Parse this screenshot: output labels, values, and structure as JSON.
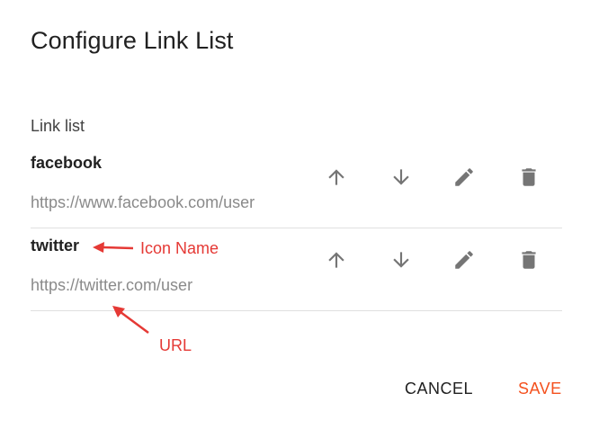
{
  "dialog": {
    "title": "Configure Link List"
  },
  "link_list": {
    "label": "Link list",
    "items": [
      {
        "name": "facebook",
        "url": "https://www.facebook.com/user"
      },
      {
        "name": "twitter",
        "url": "https://twitter.com/user"
      }
    ]
  },
  "annotations": {
    "icon_name": "Icon Name",
    "url": "URL"
  },
  "actions": {
    "cancel_label": "CANCEL",
    "save_label": "SAVE"
  },
  "colors": {
    "accent": "#f4511e",
    "annotation": "#e53935",
    "icon": "#757575"
  }
}
